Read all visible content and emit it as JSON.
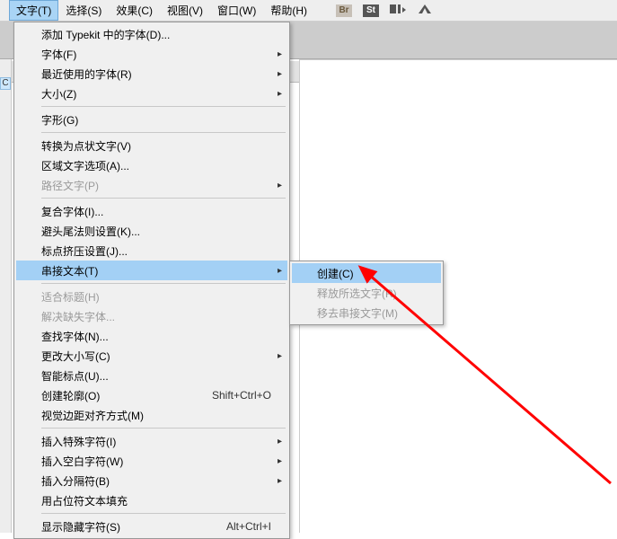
{
  "menubar": {
    "items": [
      "文字(T)",
      "选择(S)",
      "效果(C)",
      "视图(V)",
      "窗口(W)",
      "帮助(H)"
    ],
    "active_index": 0,
    "icon_labels": [
      "Br",
      "St"
    ]
  },
  "tab": {
    "close_glyph": "×",
    "side_label": "C"
  },
  "dropdown": {
    "groups": [
      [
        {
          "label": "添加 Typekit 中的字体(D)...",
          "disabled": false
        },
        {
          "label": "字体(F)",
          "disabled": false,
          "sub": true
        },
        {
          "label": "最近使用的字体(R)",
          "disabled": false,
          "sub": true
        },
        {
          "label": "大小(Z)",
          "disabled": false,
          "sub": true
        }
      ],
      [
        {
          "label": "字形(G)",
          "disabled": false
        }
      ],
      [
        {
          "label": "转换为点状文字(V)",
          "disabled": false
        },
        {
          "label": "区域文字选项(A)...",
          "disabled": false
        },
        {
          "label": "路径文字(P)",
          "disabled": true,
          "sub": true
        }
      ],
      [
        {
          "label": "复合字体(I)...",
          "disabled": false
        },
        {
          "label": "避头尾法则设置(K)...",
          "disabled": false
        },
        {
          "label": "标点挤压设置(J)...",
          "disabled": false
        },
        {
          "label": "串接文本(T)",
          "disabled": false,
          "sub": true,
          "highlight": true
        }
      ],
      [
        {
          "label": "适合标题(H)",
          "disabled": true
        },
        {
          "label": "解决缺失字体...",
          "disabled": true
        },
        {
          "label": "查找字体(N)...",
          "disabled": false
        },
        {
          "label": "更改大小写(C)",
          "disabled": false,
          "sub": true
        },
        {
          "label": "智能标点(U)...",
          "disabled": false
        },
        {
          "label": "创建轮廓(O)",
          "disabled": false,
          "shortcut": "Shift+Ctrl+O"
        },
        {
          "label": "视觉边距对齐方式(M)",
          "disabled": false
        }
      ],
      [
        {
          "label": "插入特殊字符(I)",
          "disabled": false,
          "sub": true
        },
        {
          "label": "插入空白字符(W)",
          "disabled": false,
          "sub": true
        },
        {
          "label": "插入分隔符(B)",
          "disabled": false,
          "sub": true
        },
        {
          "label": "用占位符文本填充",
          "disabled": false
        }
      ],
      [
        {
          "label": "显示隐藏字符(S)",
          "disabled": false,
          "shortcut": "Alt+Ctrl+I"
        }
      ]
    ],
    "submenu": {
      "items": [
        {
          "label": "创建(C)",
          "highlight": true
        },
        {
          "label": "释放所选文字(R)",
          "disabled": true
        },
        {
          "label": "移去串接文字(M)",
          "disabled": true
        }
      ]
    }
  }
}
